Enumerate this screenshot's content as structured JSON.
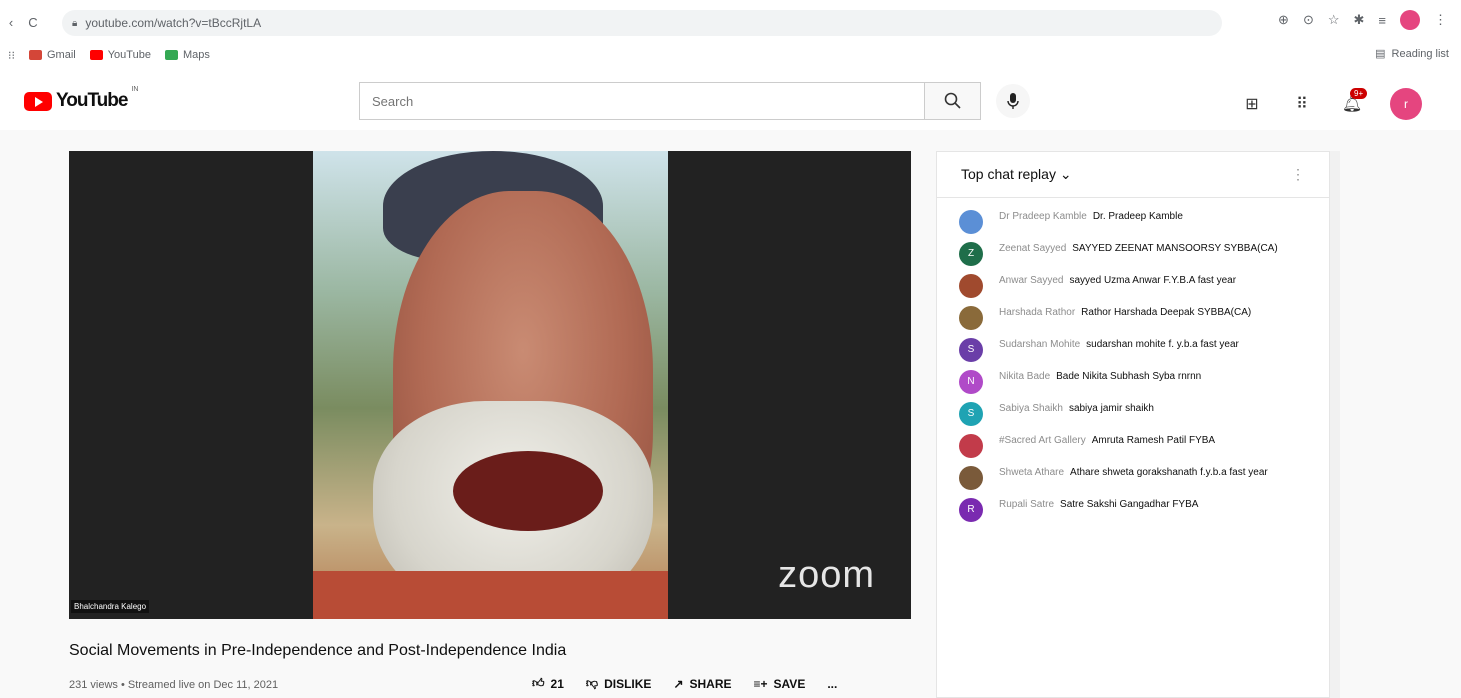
{
  "browser": {
    "back": "‹",
    "reload": "C",
    "url": "youtube.com/watch?v=tBccRjtLA",
    "bookmarks": [
      {
        "label": "Gmail",
        "color": "#d44638"
      },
      {
        "label": "YouTube",
        "color": "#ff0000"
      },
      {
        "label": "Maps",
        "color": "#34a853"
      }
    ],
    "reading_list": "Reading list"
  },
  "header": {
    "logo": "YouTube",
    "region": "IN",
    "search_placeholder": "Search",
    "notification_count": "9+",
    "avatar_letter": "r"
  },
  "video": {
    "watermark": "zoom",
    "speaker_name": "Bhalchandra Kalego",
    "title": "Social Movements in Pre-Independence and Post-Independence India",
    "meta": "231 views • Streamed live on Dec 11, 2021",
    "likes": "21",
    "dislike_label": "DISLIKE",
    "share_label": "SHARE",
    "save_label": "SAVE",
    "more_label": "..."
  },
  "chat": {
    "header": "Top chat replay",
    "messages": [
      {
        "author": "Dr Pradeep Kamble",
        "text": "Dr. Pradeep Kamble",
        "initial": "",
        "color": "#5b8fd6"
      },
      {
        "author": "Zeenat Sayyed",
        "text": "SAYYED ZEENAT MANSOORSY SYBBA(CA)",
        "initial": "Z",
        "color": "#1f6e4a"
      },
      {
        "author": "Anwar Sayyed",
        "text": "sayyed Uzma Anwar F.Y.B.A fast year",
        "initial": "",
        "color": "#a04a2e"
      },
      {
        "author": "Harshada Rathor",
        "text": "Rathor Harshada Deepak SYBBA(CA)",
        "initial": "",
        "color": "#8a6a3a"
      },
      {
        "author": "Sudarshan Mohite",
        "text": "sudarshan mohite f. y.b.a fast year",
        "initial": "S",
        "color": "#6a3ea8"
      },
      {
        "author": "Nikita Bade",
        "text": "Bade Nikita Subhash Syba rnrnn",
        "initial": "N",
        "color": "#b04ac8"
      },
      {
        "author": "Sabiya Shaikh",
        "text": "sabiya jamir shaikh",
        "initial": "S",
        "color": "#1fa3b3"
      },
      {
        "author": "#Sacred Art Gallery",
        "text": "Amruta Ramesh Patil FYBA",
        "initial": "",
        "color": "#c23b4a"
      },
      {
        "author": "Shweta Athare",
        "text": "Athare shweta gorakshanath f.y.b.a fast year",
        "initial": "",
        "color": "#7a5a3a"
      },
      {
        "author": "Rupali Satre",
        "text": "Satre Sakshi Gangadhar FYBA",
        "initial": "R",
        "color": "#7a2ab0"
      }
    ]
  }
}
